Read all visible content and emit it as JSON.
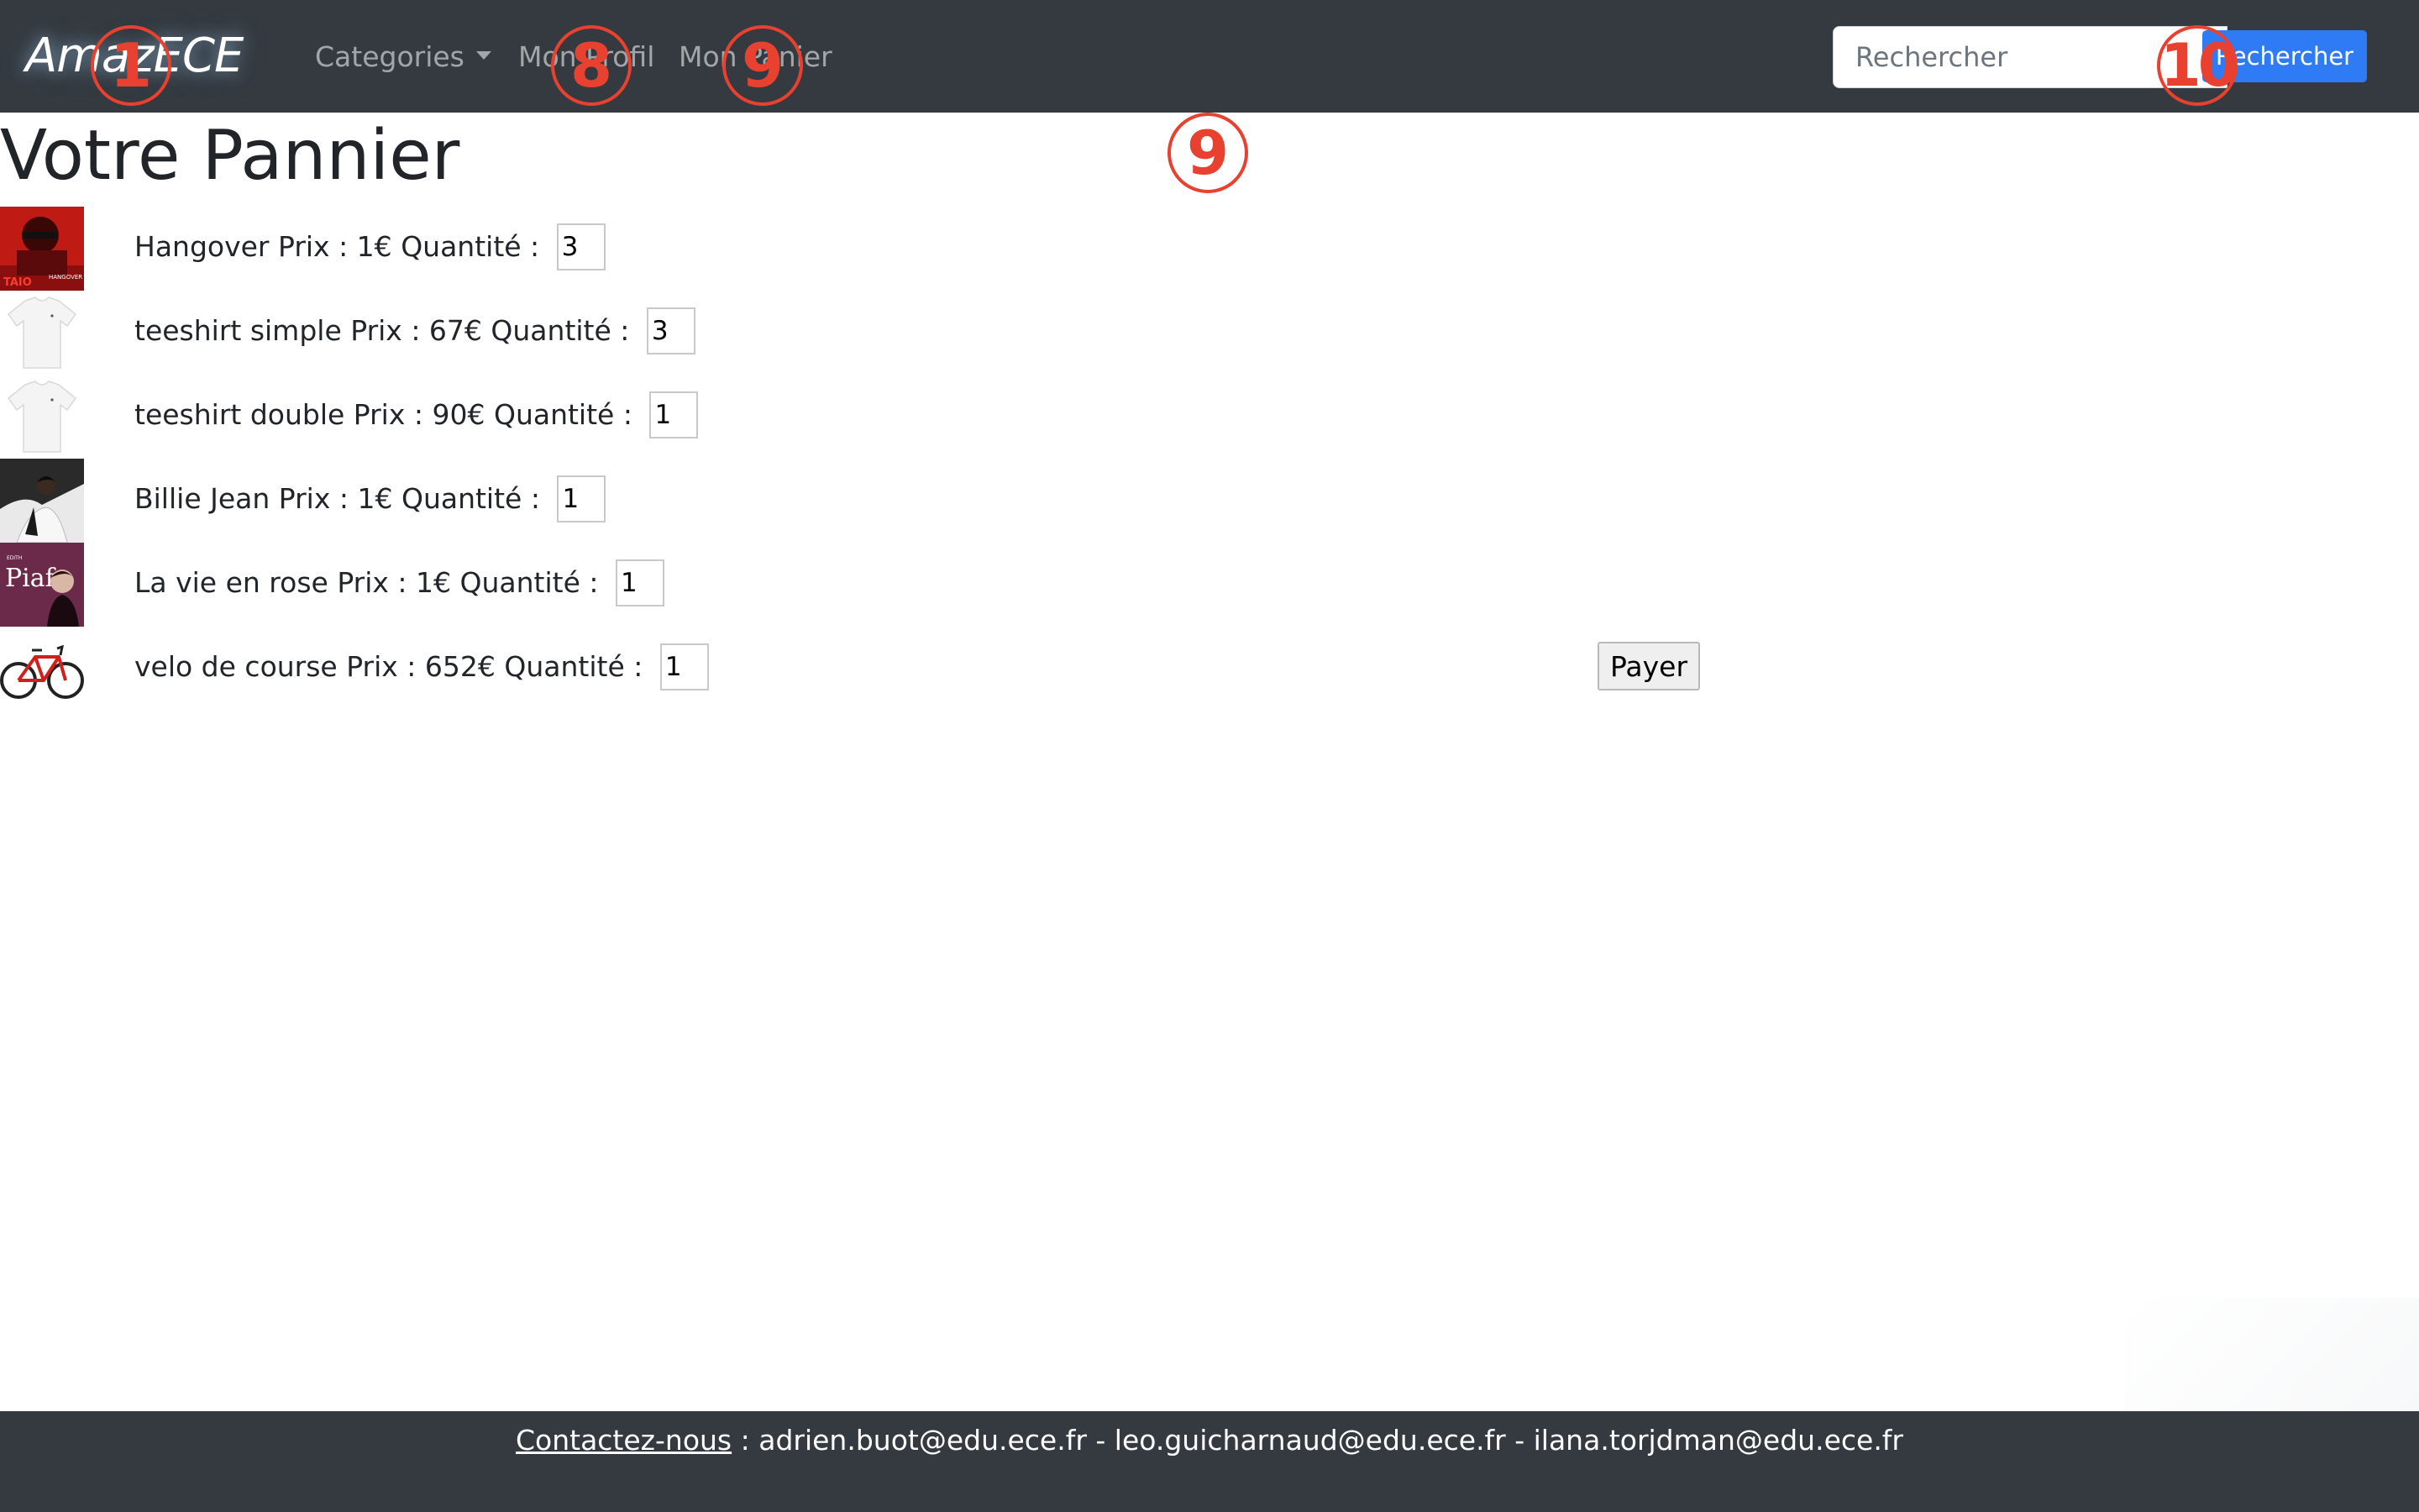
{
  "navbar": {
    "brand": "AmazECE",
    "categories_label": "Categories",
    "profile_label": "Mon Profil",
    "cart_label": "Mon Panier",
    "search_placeholder": "Rechercher",
    "search_button": "Rechercher"
  },
  "annotations": [
    "1",
    "8",
    "9",
    "10",
    "9"
  ],
  "cart": {
    "title": "Votre Pannier",
    "items": [
      {
        "name": "Hangover",
        "price_label": "Prix : 1€",
        "qty_label": "Quantité :",
        "qty": "3",
        "image": "album-cover-hangover"
      },
      {
        "name": "teeshirt simple",
        "price_label": "Prix : 67€",
        "qty_label": "Quantité :",
        "qty": "3",
        "image": "white-tshirt"
      },
      {
        "name": "teeshirt double",
        "price_label": "Prix : 90€",
        "qty_label": "Quantité :",
        "qty": "1",
        "image": "white-tshirt"
      },
      {
        "name": "Billie Jean",
        "price_label": "Prix : 1€",
        "qty_label": "Quantité :",
        "qty": "1",
        "image": "album-cover-thriller"
      },
      {
        "name": "La vie en rose",
        "price_label": "Prix : 1€",
        "qty_label": "Quantité :",
        "qty": "1",
        "image": "album-cover-piaf"
      },
      {
        "name": "velo de course",
        "price_label": "Prix : 652€",
        "qty_label": "Quantité :",
        "qty": "1",
        "image": "red-bicycle"
      }
    ],
    "pay_button": "Payer"
  },
  "footer": {
    "contact_link": "Contactez-nous",
    "emails": " : adrien.buot@edu.ece.fr - leo.guicharnaud@edu.ece.fr - ilana.torjdman@edu.ece.fr"
  },
  "colors": {
    "navbar_bg": "#343a40",
    "accent_button": "#2f7bf5",
    "annotation": "#e8412f"
  }
}
